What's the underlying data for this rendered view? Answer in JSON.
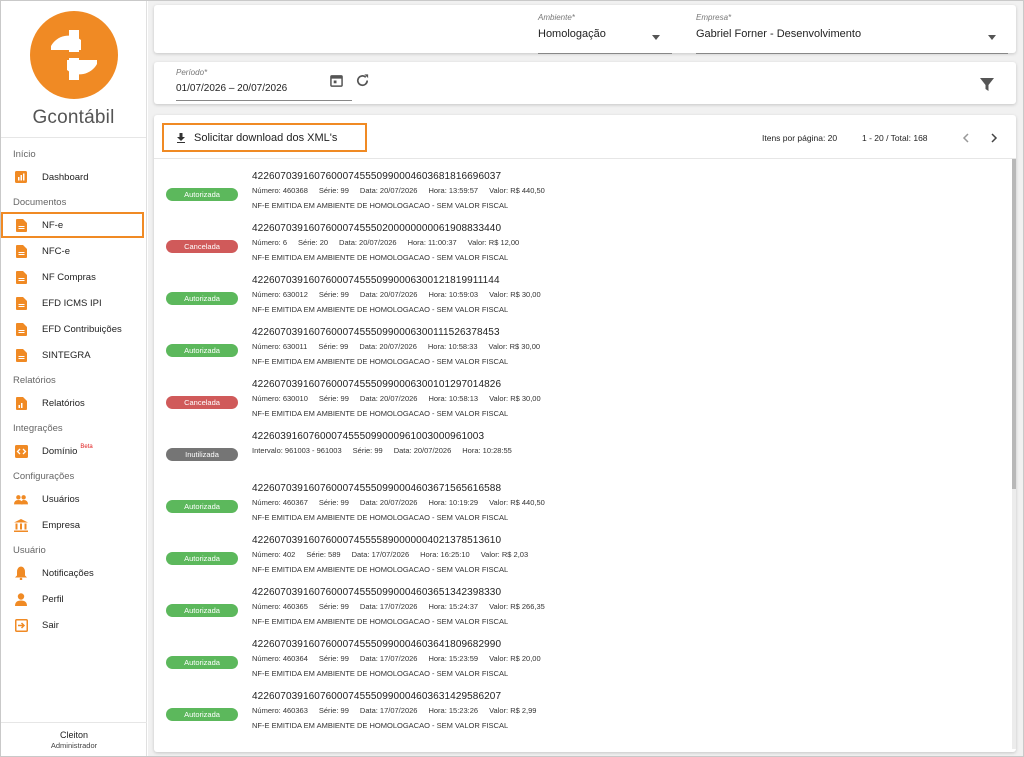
{
  "brand": {
    "name": "Gcontábil",
    "color": "#f08a24"
  },
  "sidebar": {
    "sections": [
      {
        "title": "Início",
        "items": [
          {
            "label": "Dashboard",
            "icon": "dashboard-icon"
          }
        ]
      },
      {
        "title": "Documentos",
        "items": [
          {
            "label": "NF-e",
            "icon": "document-icon",
            "active": true
          },
          {
            "label": "NFC-e",
            "icon": "document-icon"
          },
          {
            "label": "NF Compras",
            "icon": "document-icon"
          },
          {
            "label": "EFD ICMS IPI",
            "icon": "document-icon"
          },
          {
            "label": "EFD Contribuições",
            "icon": "document-icon"
          },
          {
            "label": "SINTEGRA",
            "icon": "document-icon"
          }
        ]
      },
      {
        "title": "Relatórios",
        "items": [
          {
            "label": "Relatórios",
            "icon": "report-icon"
          }
        ]
      },
      {
        "title": "Integrações",
        "items": [
          {
            "label": "Domínio",
            "icon": "code-icon",
            "badge": "Beta"
          }
        ]
      },
      {
        "title": "Configurações",
        "items": [
          {
            "label": "Usuários",
            "icon": "users-icon"
          },
          {
            "label": "Empresa",
            "icon": "bank-icon"
          }
        ]
      },
      {
        "title": "Usuário",
        "items": [
          {
            "label": "Notificações",
            "icon": "bell-icon"
          },
          {
            "label": "Perfil",
            "icon": "person-icon"
          },
          {
            "label": "Sair",
            "icon": "exit-icon"
          }
        ]
      }
    ],
    "user": {
      "name": "Cleiton",
      "role": "Administrador"
    }
  },
  "filters": {
    "ambiente": {
      "label": "Ambiente*",
      "value": "Homologação"
    },
    "empresa": {
      "label": "Empresa*",
      "value": "Gabriel Forner - Desenvolvimento"
    },
    "periodo": {
      "label": "Período*",
      "value": "01/07/2026 – 20/07/2026"
    }
  },
  "toolbar": {
    "download_label": "Solicitar download dos XML's",
    "items_per_page_label": "Itens por página: 20",
    "range_label": "1 - 20 / Total: 168"
  },
  "status_colors": {
    "Autorizada": "#5cb85c",
    "Cancelada": "#d05a5a",
    "Inutilizada": "#757575"
  },
  "documents": [
    {
      "status": "Autorizada",
      "key": "42260703916076000745550990004603681816696037",
      "meta": [
        "Número: 460368",
        "Série: 99",
        "Data: 20/07/2026",
        "Hora: 13:59:57",
        "Valor: R$ 440,50"
      ],
      "desc": "NF-E EMITIDA EM AMBIENTE DE HOMOLOGACAO - SEM VALOR FISCAL"
    },
    {
      "status": "Cancelada",
      "key": "42260703916076000745550200000000061908833440",
      "meta": [
        "Número: 6",
        "Série: 20",
        "Data: 20/07/2026",
        "Hora: 11:00:37",
        "Valor: R$ 12,00"
      ],
      "desc": "NF-E EMITIDA EM AMBIENTE DE HOMOLOGACAO - SEM VALOR FISCAL"
    },
    {
      "status": "Autorizada",
      "key": "42260703916076000745550990006300121819911144",
      "meta": [
        "Número: 630012",
        "Série: 99",
        "Data: 20/07/2026",
        "Hora: 10:59:03",
        "Valor: R$ 30,00"
      ],
      "desc": "NF-E EMITIDA EM AMBIENTE DE HOMOLOGACAO - SEM VALOR FISCAL"
    },
    {
      "status": "Autorizada",
      "key": "42260703916076000745550990006300111526378453",
      "meta": [
        "Número: 630011",
        "Série: 99",
        "Data: 20/07/2026",
        "Hora: 10:58:33",
        "Valor: R$ 30,00"
      ],
      "desc": "NF-E EMITIDA EM AMBIENTE DE HOMOLOGACAO - SEM VALOR FISCAL"
    },
    {
      "status": "Cancelada",
      "key": "42260703916076000745550990006300101297014826",
      "meta": [
        "Número: 630010",
        "Série: 99",
        "Data: 20/07/2026",
        "Hora: 10:58:13",
        "Valor: R$ 30,00"
      ],
      "desc": "NF-E EMITIDA EM AMBIENTE DE HOMOLOGACAO - SEM VALOR FISCAL"
    },
    {
      "status": "Inutilizada",
      "key": "42260391607600074555099000961003000961003",
      "meta": [
        "Intervalo: 961003 - 961003",
        "Série: 99",
        "Data: 20/07/2026",
        "Hora: 10:28:55"
      ],
      "desc": ""
    },
    {
      "status": "Autorizada",
      "key": "42260703916076000745550990004603671565616588",
      "meta": [
        "Número: 460367",
        "Série: 99",
        "Data: 20/07/2026",
        "Hora: 10:19:29",
        "Valor: R$ 440,50"
      ],
      "desc": "NF-E EMITIDA EM AMBIENTE DE HOMOLOGACAO - SEM VALOR FISCAL"
    },
    {
      "status": "Autorizada",
      "key": "42260703916076000745555890000004021378513610",
      "meta": [
        "Número: 402",
        "Série: 589",
        "Data: 17/07/2026",
        "Hora: 16:25:10",
        "Valor: R$ 2,03"
      ],
      "desc": "NF-E EMITIDA EM AMBIENTE DE HOMOLOGACAO - SEM VALOR FISCAL"
    },
    {
      "status": "Autorizada",
      "key": "42260703916076000745550990004603651342398330",
      "meta": [
        "Número: 460365",
        "Série: 99",
        "Data: 17/07/2026",
        "Hora: 15:24:37",
        "Valor: R$ 266,35"
      ],
      "desc": "NF-E EMITIDA EM AMBIENTE DE HOMOLOGACAO - SEM VALOR FISCAL"
    },
    {
      "status": "Autorizada",
      "key": "42260703916076000745550990004603641809682990",
      "meta": [
        "Número: 460364",
        "Série: 99",
        "Data: 17/07/2026",
        "Hora: 15:23:59",
        "Valor: R$ 20,00"
      ],
      "desc": "NF-E EMITIDA EM AMBIENTE DE HOMOLOGACAO - SEM VALOR FISCAL"
    },
    {
      "status": "Autorizada",
      "key": "42260703916076000745550990004603631429586207",
      "meta": [
        "Número: 460363",
        "Série: 99",
        "Data: 17/07/2026",
        "Hora: 15:23:26",
        "Valor: R$ 2,99"
      ],
      "desc": "NF-E EMITIDA EM AMBIENTE DE HOMOLOGACAO - SEM VALOR FISCAL"
    }
  ]
}
